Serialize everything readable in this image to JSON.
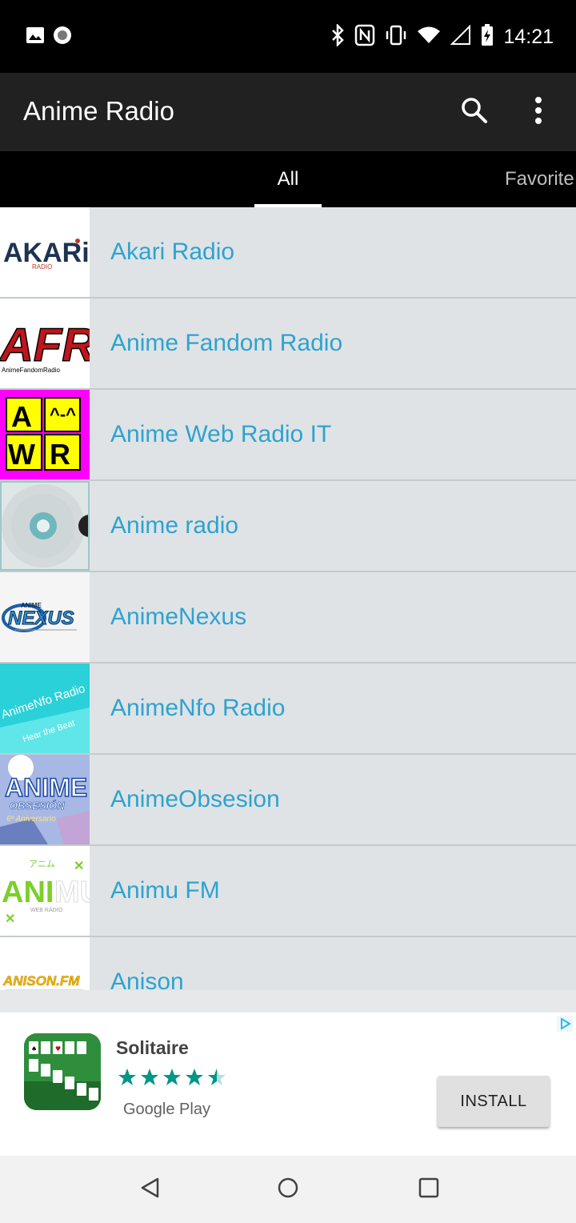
{
  "status_bar": {
    "time": "14:21",
    "left_icons": [
      "image-icon",
      "record-icon"
    ],
    "right_icons": [
      "bluetooth-icon",
      "nfc-icon",
      "vibrate-icon",
      "wifi-icon",
      "signal-icon",
      "battery-charging-icon"
    ]
  },
  "app_bar": {
    "title": "Anime Radio",
    "actions": [
      "search-icon",
      "more-vert-icon"
    ]
  },
  "tabs": {
    "items": [
      {
        "label": "All",
        "selected": true
      },
      {
        "label": "Favorite",
        "selected": false
      }
    ]
  },
  "stations": [
    {
      "name": "Akari Radio"
    },
    {
      "name": "Anime Fandom Radio"
    },
    {
      "name": "Anime Web Radio IT"
    },
    {
      "name": "Anime radio"
    },
    {
      "name": "AnimeNexus"
    },
    {
      "name": "AnimeNfo Radio"
    },
    {
      "name": "AnimeObsesion"
    },
    {
      "name": "Animu FM"
    },
    {
      "name": "Anison"
    }
  ],
  "ad": {
    "title": "Solitaire",
    "rating": 4.5,
    "store": "Google Play",
    "install_label": "INSTALL",
    "star_color": "#009688"
  },
  "colors": {
    "accent": "#2ea3cf",
    "app_bar": "#212121",
    "list_bg": "#dfe3e6"
  },
  "nav_bar": {
    "buttons": [
      "back-icon",
      "home-icon",
      "recents-icon"
    ]
  }
}
